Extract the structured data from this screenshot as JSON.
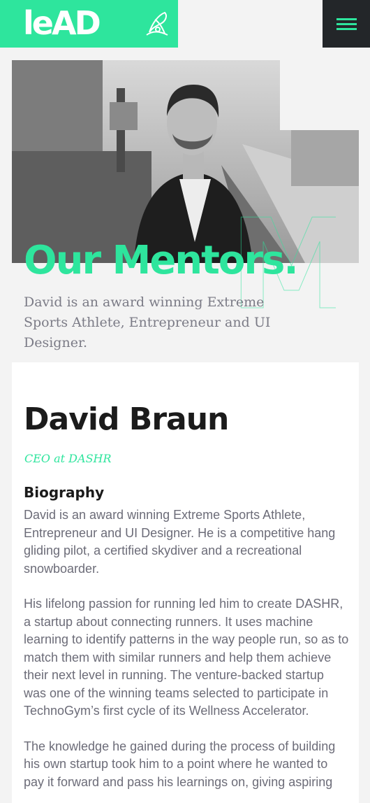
{
  "header": {
    "logo_text": "leAD",
    "logo_mark_icon": "hang-glider-icon",
    "menu_icon": "hamburger-icon",
    "accent": "#2ee59d",
    "menu_bg": "#232629"
  },
  "hero": {
    "photo": "mentor-portrait-photo",
    "title": "Our Mentors.",
    "watermark_letter": "M",
    "description": "David is an award winning Extreme Sports Athlete, Entrepreneur and UI Designer."
  },
  "profile": {
    "name": "David Braun",
    "role": "CEO at DASHR",
    "bio_heading": "Biography",
    "bio": [
      "David is an award winning Extreme Sports Athlete, Entrepreneur and UI Designer. He is a competitive hang gliding pilot, a certified skydiver and a recreational snowboarder.",
      "His lifelong passion for running led him to create DASHR, a startup about connecting runners. It uses machine learning to identify patterns in the way people run, so as to match them with similar runners and help them achieve their next level in running. The venture-backed startup was one of the winning teams selected to participate in TechnoGym’s first cycle of its Wellness Accelerator.",
      "The knowledge he gained during the process of building his own startup took him to a point where he wanted to pay it forward and pass his learnings on, giving aspiring"
    ]
  }
}
